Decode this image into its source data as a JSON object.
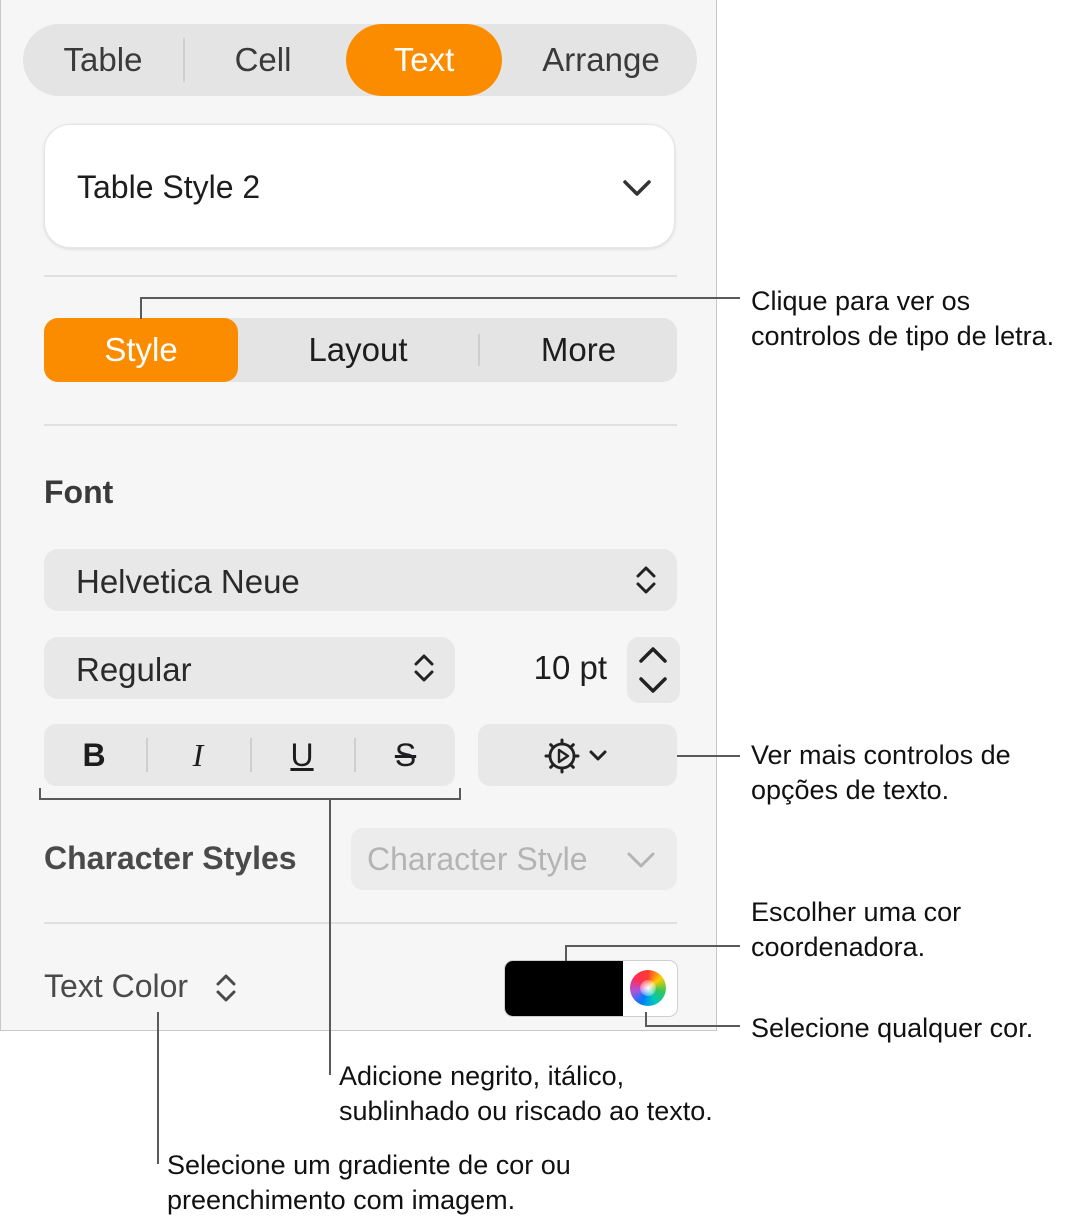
{
  "top_tabs": [
    "Table",
    "Cell",
    "Text",
    "Arrange"
  ],
  "active_top_tab": "Text",
  "table_style": {
    "value": "Table Style 2"
  },
  "sub_tabs": [
    "Style",
    "Layout",
    "More"
  ],
  "active_sub_tab": "Style",
  "font_section": {
    "title": "Font",
    "family": "Helvetica Neue",
    "typeface": "Regular",
    "size": "10 pt"
  },
  "format_buttons": {
    "bold": "B",
    "italic": "I",
    "underline": "U",
    "strike": "S"
  },
  "character_styles": {
    "label": "Character Styles",
    "placeholder": "Character Style"
  },
  "text_color": {
    "label": "Text Color",
    "swatch": "#000000"
  },
  "accent_color": "#fb8c00",
  "icons": {
    "gear": "gear-icon",
    "wheel": "color-wheel-icon"
  },
  "callouts": {
    "style_tab": "Clique para ver os\ncontrolos de tipo de letra.",
    "more_options": "Ver mais controlos de\nopções de texto.",
    "coordinating_color": "Escolher uma cor\ncoordenadora.",
    "any_color": "Selecione qualquer cor.",
    "format": "Adicione negrito, itálico,\nsublinhado ou riscado ao texto.",
    "gradient": "Selecione um gradiente de cor ou\npreenchimento com imagem."
  }
}
